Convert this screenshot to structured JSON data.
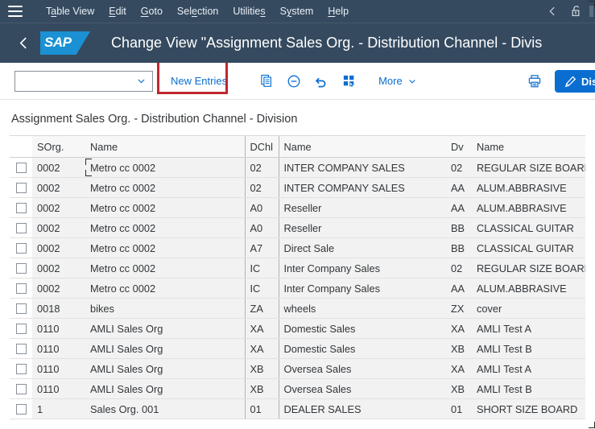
{
  "menubar": {
    "burger_name": "menu-button",
    "items": [
      {
        "label": "Table View",
        "mnemonic_index": 1
      },
      {
        "label": "Edit",
        "mnemonic_index": 0
      },
      {
        "label": "Goto",
        "mnemonic_index": 0
      },
      {
        "label": "Selection",
        "mnemonic_index": 3
      },
      {
        "label": "Utilities",
        "mnemonic_index": 8
      },
      {
        "label": "System",
        "mnemonic_index": 1
      },
      {
        "label": "Help",
        "mnemonic_index": 0
      }
    ],
    "right_icons": [
      "chevron-left-icon",
      "unlocked-padlock-icon"
    ]
  },
  "header": {
    "back_icon": "back-chevron-icon",
    "logo_text": "SAP",
    "title": "Change View \"Assignment Sales Org. - Distribution Channel - Divis"
  },
  "toolbar": {
    "combo_value": "",
    "combo_placeholder": "",
    "new_entries_label": "New Entries",
    "icons": [
      {
        "name": "copy-icon"
      },
      {
        "name": "delete-minus-icon"
      },
      {
        "name": "undo-icon"
      },
      {
        "name": "select-all-icon"
      }
    ],
    "more_label": "More",
    "print_icon": "print-icon",
    "display_label": "Displa",
    "highlight_color": "#c0272d",
    "accent_color": "#0a6ed1"
  },
  "content": {
    "section_title": "Assignment Sales Org. - Distribution Channel - Division",
    "table": {
      "columns": [
        "SOrg.",
        "Name",
        "DChl",
        "Name",
        "Dv",
        "Name"
      ],
      "rows": [
        {
          "sorg": "0002",
          "name1": "Metro cc  0002",
          "dchl": "02",
          "name2": "INTER COMPANY SALES",
          "dv": "02",
          "name3": "REGULAR SIZE BOARD"
        },
        {
          "sorg": "0002",
          "name1": "Metro cc  0002",
          "dchl": "02",
          "name2": "INTER COMPANY SALES",
          "dv": "AA",
          "name3": "ALUM.ABBRASIVE"
        },
        {
          "sorg": "0002",
          "name1": "Metro cc  0002",
          "dchl": "A0",
          "name2": "Reseller",
          "dv": "AA",
          "name3": "ALUM.ABBRASIVE"
        },
        {
          "sorg": "0002",
          "name1": "Metro cc  0002",
          "dchl": "A0",
          "name2": "Reseller",
          "dv": "BB",
          "name3": "CLASSICAL GUITAR"
        },
        {
          "sorg": "0002",
          "name1": "Metro cc  0002",
          "dchl": "A7",
          "name2": "Direct Sale",
          "dv": "BB",
          "name3": "CLASSICAL GUITAR"
        },
        {
          "sorg": "0002",
          "name1": "Metro cc  0002",
          "dchl": "IC",
          "name2": "Inter Company Sales",
          "dv": "02",
          "name3": "REGULAR SIZE BOARD"
        },
        {
          "sorg": "0002",
          "name1": "Metro cc  0002",
          "dchl": "IC",
          "name2": "Inter Company Sales",
          "dv": "AA",
          "name3": "ALUM.ABBRASIVE"
        },
        {
          "sorg": "0018",
          "name1": "bikes",
          "dchl": "ZA",
          "name2": "wheels",
          "dv": "ZX",
          "name3": "cover"
        },
        {
          "sorg": "0110",
          "name1": "AMLI Sales Org",
          "dchl": "XA",
          "name2": "Domestic Sales",
          "dv": "XA",
          "name3": "AMLI Test A"
        },
        {
          "sorg": "0110",
          "name1": "AMLI Sales Org",
          "dchl": "XA",
          "name2": "Domestic Sales",
          "dv": "XB",
          "name3": "AMLI Test B"
        },
        {
          "sorg": "0110",
          "name1": "AMLI Sales Org",
          "dchl": "XB",
          "name2": "Oversea Sales",
          "dv": "XA",
          "name3": "AMLI Test A"
        },
        {
          "sorg": "0110",
          "name1": "AMLI Sales Org",
          "dchl": "XB",
          "name2": "Oversea Sales",
          "dv": "XB",
          "name3": "AMLI Test B"
        },
        {
          "sorg": "1",
          "name1": "Sales Org. 001",
          "dchl": "01",
          "name2": "DEALER SALES",
          "dv": "01",
          "name3": "SHORT SIZE BOARD"
        }
      ]
    }
  }
}
